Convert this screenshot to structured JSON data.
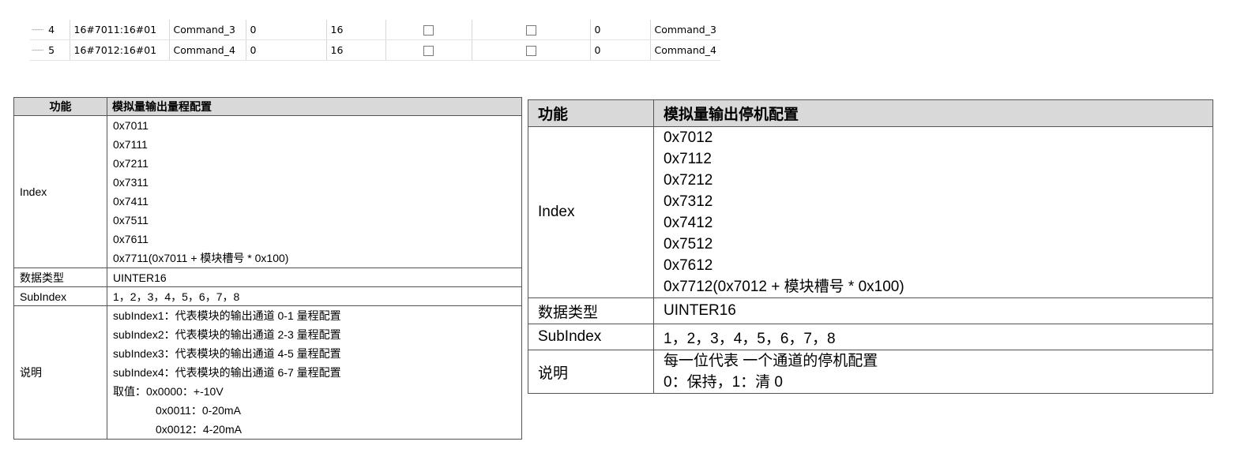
{
  "grid_rows": [
    {
      "no": "4",
      "index": "16#7011:16#01",
      "name": "Command_3",
      "v1": "0",
      "v2": "16",
      "v3": "0",
      "desc": "Command_3"
    },
    {
      "no": "5",
      "index": "16#7012:16#01",
      "name": "Command_4",
      "v1": "0",
      "v2": "16",
      "v3": "0",
      "desc": "Command_4"
    }
  ],
  "left_table": {
    "header_key": "功能",
    "header_val": "模拟量输出量程配置",
    "index_label": "Index",
    "index_values": [
      "0x7011",
      "0x7111",
      "0x7211",
      "0x7311",
      "0x7411",
      "0x7511",
      "0x7611",
      "0x7711(0x7011 + 模块槽号 * 0x100)"
    ],
    "dtype_label": "数据类型",
    "dtype_value": "UINTER16",
    "sub_label": "SubIndex",
    "sub_value": "1，2，3，4，5，6，7，8",
    "desc_label": "说明",
    "desc_lines": [
      "subIndex1：代表模块的输出通道 0-1 量程配置",
      "subIndex2：代表模块的输出通道 2-3 量程配置",
      "subIndex3：代表模块的输出通道 4-5 量程配置",
      "subIndex4：代表模块的输出通道 6-7 量程配置",
      "取值：0x0000：+-10V"
    ],
    "desc_values": [
      "0x0011：0-20mA",
      "0x0012：4-20mA"
    ]
  },
  "right_table": {
    "header_key": "功能",
    "header_val": "模拟量输出停机配置",
    "index_label": "Index",
    "index_values": [
      "0x7012",
      "0x7112",
      "0x7212",
      "0x7312",
      "0x7412",
      "0x7512",
      "0x7612",
      "0x7712(0x7012 + 模块槽号 * 0x100)"
    ],
    "dtype_label": "数据类型",
    "dtype_value": "UINTER16",
    "sub_label": "SubIndex",
    "sub_value": "1，2，3，4，5，6，7，8",
    "desc_label": "说明",
    "desc_lines": [
      "每一位代表 一个通道的停机配置",
      "0：保持，1：清 0"
    ]
  }
}
